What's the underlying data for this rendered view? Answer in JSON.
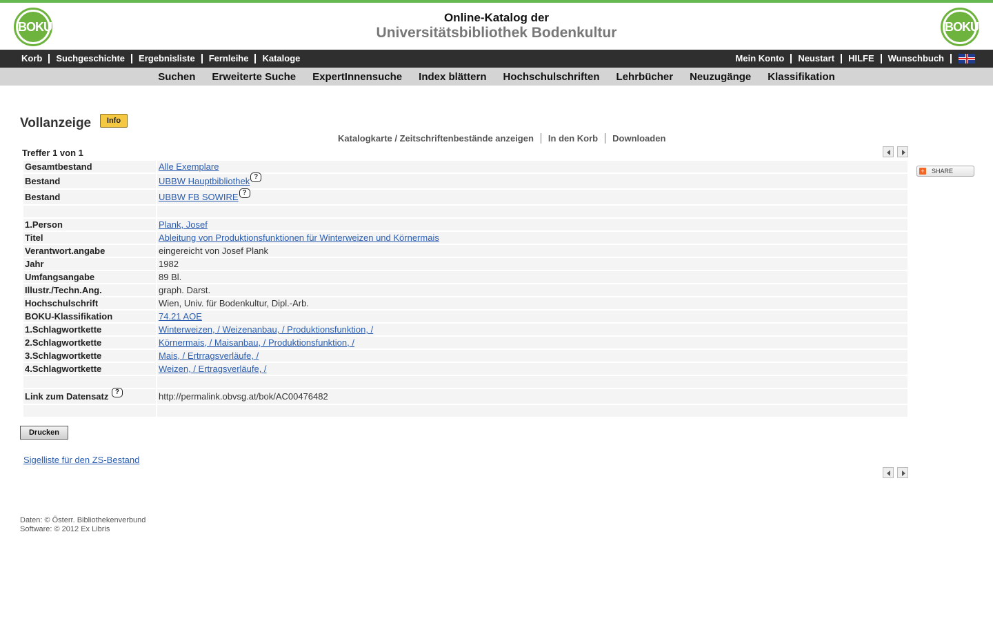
{
  "header": {
    "logo_text": "BOKU",
    "title_line1": "Online-Katalog der",
    "title_line2": "Universitätsbibliothek Bodenkultur"
  },
  "nav_top": {
    "left": [
      "Korb",
      "Suchgeschichte",
      "Ergebnisliste",
      "Fernleihe",
      "Kataloge"
    ],
    "right": [
      "Mein Konto",
      "Neustart",
      "HILFE",
      "Wunschbuch"
    ],
    "language_icon": "uk-flag-icon"
  },
  "nav_main": [
    "Suchen",
    "Erweiterte Suche",
    "ExpertInnensuche",
    "Index blättern",
    "Hochschulschriften",
    "Lehrbücher",
    "Neuzugänge",
    "Klassifikation"
  ],
  "page": {
    "title": "Vollanzeige",
    "info_button": "Info",
    "actions": [
      "Katalogkarte / Zeitschriftenbestände anzeigen",
      "In den Korb",
      "Downloaden"
    ],
    "hit_counter": "Treffer 1 von 1",
    "share_label": "SHARE"
  },
  "record": {
    "holdings": [
      {
        "label": "Gesamtbestand",
        "value": "Alle Exemplare",
        "help": false
      },
      {
        "label": "Bestand",
        "value": "UBBW Hauptbibliothek",
        "help": true
      },
      {
        "label": "Bestand",
        "value": "UBBW FB SOWIRE",
        "help": true
      }
    ],
    "fields": [
      {
        "label": "1.Person",
        "value": "Plank, Josef",
        "link": true
      },
      {
        "label": "Titel",
        "value": "Ableitung von Produktionsfunktionen für Winterweizen und Körnermais ",
        "link": true
      },
      {
        "label": "Verantwort.angabe",
        "value": "eingereicht von Josef Plank",
        "link": false
      },
      {
        "label": "Jahr",
        "value": "1982",
        "link": false
      },
      {
        "label": "Umfangsangabe",
        "value": "89 Bl.",
        "link": false
      },
      {
        "label": "Illustr./Techn.Ang.",
        "value": "graph. Darst.",
        "link": false
      },
      {
        "label": "Hochschulschrift",
        "value": "Wien, Univ. für Bodenkultur, Dipl.-Arb.",
        "link": false
      },
      {
        "label": "BOKU-Klassifikation",
        "value": "74.21 AOE ",
        "link": true
      },
      {
        "label": "1.Schlagwortkette",
        "value": "Winterweizen, / Weizenanbau, / Produktionsfunktion, / ",
        "link": true
      },
      {
        "label": "2.Schlagwortkette",
        "value": "Körnermais, / Maisanbau, / Produktionsfunktion, / ",
        "link": true
      },
      {
        "label": "3.Schlagwortkette",
        "value": "Mais, / Ertrragsverläufe, / ",
        "link": true
      },
      {
        "label": "4.Schlagwortkette",
        "value": "Weizen, / Ertragsverläufe, / ",
        "link": true
      }
    ],
    "permalink": {
      "label": "Link zum Datensatz",
      "value": "http://permalink.obvsg.at/bok/AC00476482"
    }
  },
  "buttons": {
    "print": "Drucken"
  },
  "sigel_link": "Sigelliste für den ZS-Bestand",
  "footer": {
    "line1": "Daten: © Österr. Bibliothekenverbund",
    "line2": "Software: © 2012 Ex Libris"
  }
}
